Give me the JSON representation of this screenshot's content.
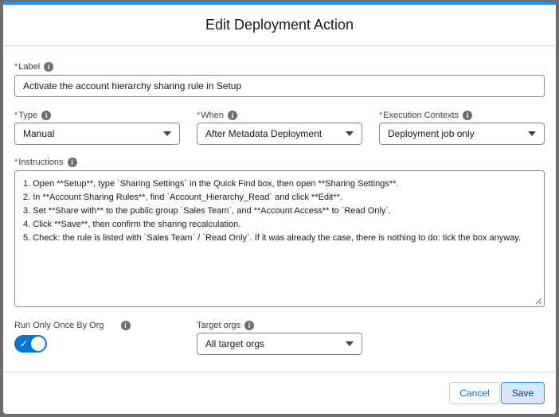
{
  "dialog": {
    "title": "Edit Deployment Action"
  },
  "required_marker": "*",
  "info_icon_glyph": "i",
  "fields": {
    "label": {
      "label": "Label",
      "required": true,
      "value": "Activate the account hierarchy sharing rule in Setup"
    },
    "type": {
      "label": "Type",
      "required": true,
      "value": "Manual"
    },
    "when": {
      "label": "When",
      "required": true,
      "value": "After Metadata Deployment"
    },
    "execution_contexts": {
      "label": "Execution Contexts",
      "required": true,
      "value": "Deployment job only"
    },
    "instructions": {
      "label": "Instructions",
      "required": true,
      "lines": [
        "1. Open **Setup**, type `Sharing Settings` in the Quick Find box, then open **Sharing Settings**.",
        "2. In **Account Sharing Rules**, find `Account_Hierarchy_Read` and click **Edit**.",
        "3. Set **Share with** to the public group `Sales Team`, and **Account Access** to `Read Only`.",
        "4. Click **Save**, then confirm the sharing recalculation.",
        "5. Check: the rule is listed with `Sales Team` / `Read Only`. If it was already the case, there is nothing to do: tick the box anyway."
      ]
    },
    "run_only_once": {
      "label": "Run Only Once By Org",
      "checked": true
    },
    "target_orgs": {
      "label": "Target orgs",
      "value": "All target orgs"
    }
  },
  "footer": {
    "cancel_label": "Cancel",
    "save_label": "Save"
  },
  "colors": {
    "accent": "#0176d3",
    "required": "#c23934",
    "save_bg": "#d8e6fe"
  }
}
